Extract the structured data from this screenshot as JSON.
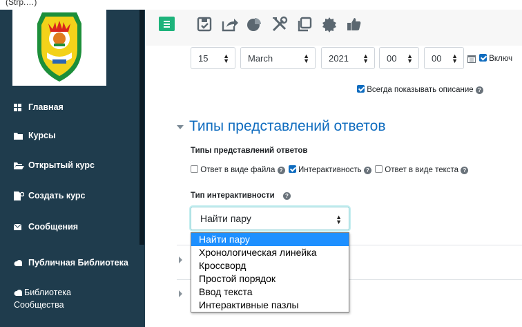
{
  "window": {
    "title_fragment": "(Strp.…)"
  },
  "sidebar": {
    "items": [
      {
        "label": "Главная",
        "icon": "grid-icon"
      },
      {
        "label": "Курсы",
        "icon": "folder-icon"
      },
      {
        "label": "Открытый курс",
        "icon": "folder-open-icon"
      },
      {
        "label": "Создать курс",
        "icon": "file-cog-icon"
      },
      {
        "label": "Сообщения",
        "icon": "envelope-icon"
      },
      {
        "label": "Публичная Библиотека",
        "icon": "cloud-icon"
      },
      {
        "label": "Библиотека Сообщества",
        "icon": "cloud-icon"
      }
    ]
  },
  "toolbar": {
    "icons": [
      "save-icon",
      "share-icon",
      "pie-chart-icon",
      "tools-icon",
      "copy-icon",
      "badge-icon",
      "thumbs-up-icon"
    ]
  },
  "date_row": {
    "day": "15",
    "month": "March",
    "year": "2021",
    "hour": "00",
    "minute": "00",
    "enable_label": "Включ"
  },
  "always_show_description": "Всегда показывать описание",
  "submission_types": {
    "section_title": "Типы представлений ответов",
    "field_label": "Типы представлений ответов",
    "options": [
      {
        "label": "Ответ в виде файла",
        "checked": false
      },
      {
        "label": "Интерактивность",
        "checked": true
      },
      {
        "label": "Ответ в виде текста",
        "checked": false
      }
    ]
  },
  "interactivity": {
    "label": "Тип интерактивности",
    "selected": "Найти пару",
    "options": [
      "Найти пару",
      "Хронологическая линейка",
      "Кроссворд",
      "Простой порядок",
      "Ввод текста",
      "Интерактивные пазлы"
    ]
  },
  "colors": {
    "sidebar": "#1f3c4d",
    "accent": "#0f6cbf",
    "menu_button": "#1db37b",
    "highlight": "#1e90ff"
  }
}
